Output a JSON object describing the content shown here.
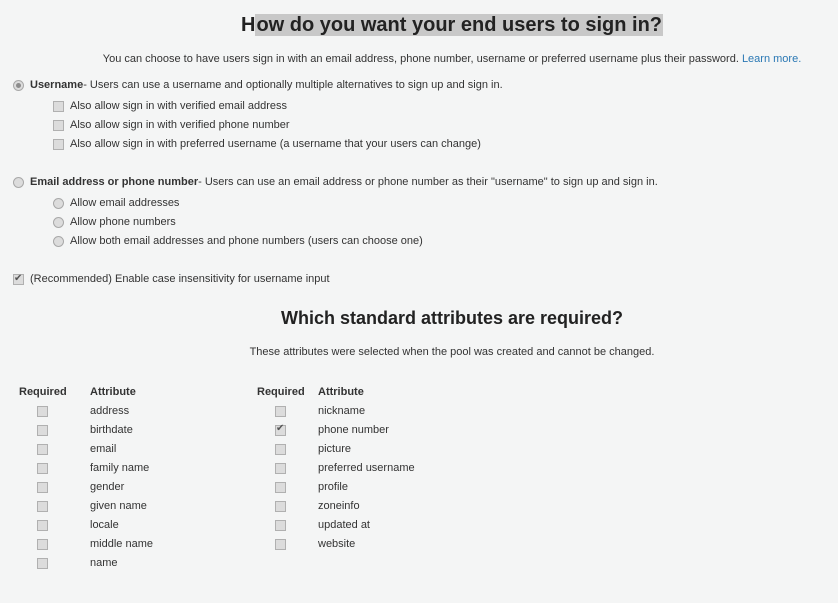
{
  "page": {
    "title_highlighted": "ow do you want your end users to sign in?",
    "title_first": "H",
    "subtitle": "You can choose to have users sign in with an email address, phone number, username or preferred username plus their password.",
    "learn_more": "Learn more."
  },
  "signin": {
    "username_option": {
      "label": "Username",
      "description": " - Users can use a username and optionally multiple alternatives to sign up and sign in.",
      "selected": true,
      "sub_options": [
        {
          "label": "Also allow sign in with verified email address",
          "checked": false
        },
        {
          "label": "Also allow sign in with verified phone number",
          "checked": false
        },
        {
          "label": "Also allow sign in with preferred username (a username that your users can change)",
          "checked": false
        }
      ]
    },
    "email_phone_option": {
      "label": "Email address or phone number",
      "description": " - Users can use an email address or phone number as their \"username\" to sign up and sign in.",
      "selected": false,
      "sub_options": [
        {
          "label": "Allow email addresses"
        },
        {
          "label": "Allow phone numbers"
        },
        {
          "label": "Allow both email addresses and phone numbers (users can choose one)"
        }
      ]
    },
    "case_insensitive": {
      "label": "(Recommended) Enable case insensitivity for username input",
      "checked": true
    }
  },
  "attributes": {
    "title": "Which standard attributes are required?",
    "note": "These attributes were selected when the pool was created and cannot be changed.",
    "col_required": "Required",
    "col_attribute": "Attribute",
    "left": [
      {
        "name": "address",
        "required": false
      },
      {
        "name": "birthdate",
        "required": false
      },
      {
        "name": "email",
        "required": false
      },
      {
        "name": "family name",
        "required": false
      },
      {
        "name": "gender",
        "required": false
      },
      {
        "name": "given name",
        "required": false
      },
      {
        "name": "locale",
        "required": false
      },
      {
        "name": "middle name",
        "required": false
      },
      {
        "name": "name",
        "required": false
      }
    ],
    "right": [
      {
        "name": "nickname",
        "required": false
      },
      {
        "name": "phone number",
        "required": true
      },
      {
        "name": "picture",
        "required": false
      },
      {
        "name": "preferred username",
        "required": false
      },
      {
        "name": "profile",
        "required": false
      },
      {
        "name": "zoneinfo",
        "required": false
      },
      {
        "name": "updated at",
        "required": false
      },
      {
        "name": "website",
        "required": false
      }
    ]
  }
}
